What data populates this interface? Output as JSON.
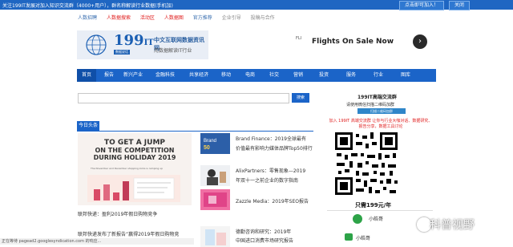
{
  "notice": {
    "text": "关注199IT发展对加入知识交流群（4000+用户），群名称解读行业数据(手机加)",
    "join_label": "点击即可加入！",
    "close_label": "关闭"
  },
  "links": [
    "人数招聘",
    "人数据搜索",
    "活动区",
    "人数据图",
    "官方推荐",
    "企业引导",
    "投稿与合作"
  ],
  "logo": {
    "number": "199",
    "suffix": "IT",
    "name_cn": "中文互联网数据资讯网",
    "slogan_cn": "用数据解读IT行业",
    "tag": "数据说话"
  },
  "ad": {
    "label": "FLI",
    "title": "Flights On Sale Now",
    "go": "›"
  },
  "nav": [
    "首页",
    "报告",
    "新兴产业",
    "金融科技",
    "共享经济",
    "移动",
    "电商",
    "社交",
    "营销",
    "投资",
    "服务",
    "行业",
    "图库"
  ],
  "search": {
    "placeholder": "",
    "button": "搜索"
  },
  "section": {
    "today": "今日头条"
  },
  "feature": {
    "line1": "TO GET A JUMP",
    "line2": "ON THE COMPETITION",
    "line3": "DURING HOLIDAY 2019",
    "sub": "The November and December shopping kicks is ramping up",
    "caption": "联邦快递：盈利2019年假日购物竞争",
    "caption2": "联邦快递发布了新报告“赢得2019年假日购物竞"
  },
  "news": [
    {
      "title": "Brand Finance：2019全球最有",
      "line2": "价值最有影响力媒体品牌Top50排行",
      "thumb_label": "Brand 50"
    },
    {
      "title": "AlixPartners：零售现象—2019",
      "line2": "年双十一之前企业的数字指南",
      "thumb_label": ""
    },
    {
      "title": "Zazzle Media：2019年SEO报告",
      "line2": "",
      "thumb_label": "Luxury & Premium 50"
    },
    {
      "title": "德勤咨询和研究：2019年",
      "line2": "中国进口消费市场研究报告",
      "thumb_label": ""
    }
  ],
  "sidebar": {
    "title": "199IT高端交流群",
    "sub1": "请使用微信扫描二维码加群",
    "btn": "扫描二维码加群",
    "red": "加入 199IT 高端交流群 让你与行业大咖对话、数据研究、报告分享，数据工具讨论",
    "price": "只需199元/年",
    "wx1": "小皓哥",
    "wx2": "小皓哥"
  },
  "status": "正在等待 pagead2.googlesyndication.com 的响应...",
  "watermark": "科普视野"
}
